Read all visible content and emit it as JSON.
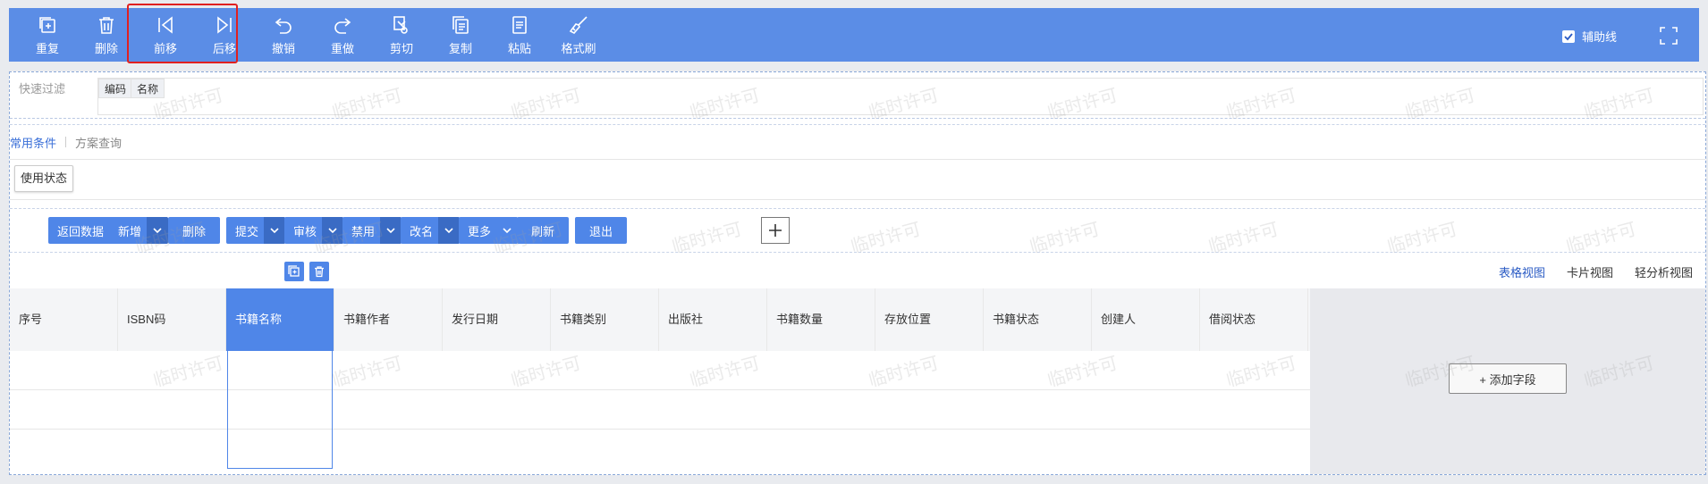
{
  "toolbar": {
    "items": [
      {
        "label": "重复",
        "icon": "duplicate-icon"
      },
      {
        "label": "删除",
        "icon": "trash-icon"
      },
      {
        "label": "前移",
        "icon": "move-back-icon"
      },
      {
        "label": "后移",
        "icon": "move-forward-icon"
      },
      {
        "label": "撤销",
        "icon": "undo-icon"
      },
      {
        "label": "重做",
        "icon": "redo-icon"
      },
      {
        "label": "剪切",
        "icon": "cut-icon"
      },
      {
        "label": "复制",
        "icon": "copy-icon"
      },
      {
        "label": "粘贴",
        "icon": "paste-icon"
      },
      {
        "label": "格式刷",
        "icon": "format-brush-icon"
      }
    ],
    "aux_label": "辅助线",
    "aux_checked": true,
    "color": "#5b8de6"
  },
  "filter": {
    "label": "快速过滤",
    "tags": [
      "编码",
      "名称"
    ]
  },
  "tabs": {
    "active": "常用条件",
    "inactive": "方案查询"
  },
  "status_button": "使用状态",
  "actions": {
    "return_data": "返回数据",
    "add": "新增",
    "delete": "删除",
    "submit": "提交",
    "audit": "审核",
    "disable": "禁用",
    "rename": "改名",
    "more": "更多",
    "refresh": "刷新",
    "exit": "退出"
  },
  "views": {
    "table": "表格视图",
    "card": "卡片视图",
    "analysis": "轻分析视图"
  },
  "table": {
    "columns": [
      "序号",
      "ISBN码",
      "书籍名称",
      "书籍作者",
      "发行日期",
      "书籍类别",
      "出版社",
      "书籍数量",
      "存放位置",
      "书籍状态",
      "创建人",
      "借阅状态"
    ],
    "selected_column": "书籍名称",
    "rows": 3
  },
  "add_field": "+ 添加字段",
  "watermark": "临时许可"
}
